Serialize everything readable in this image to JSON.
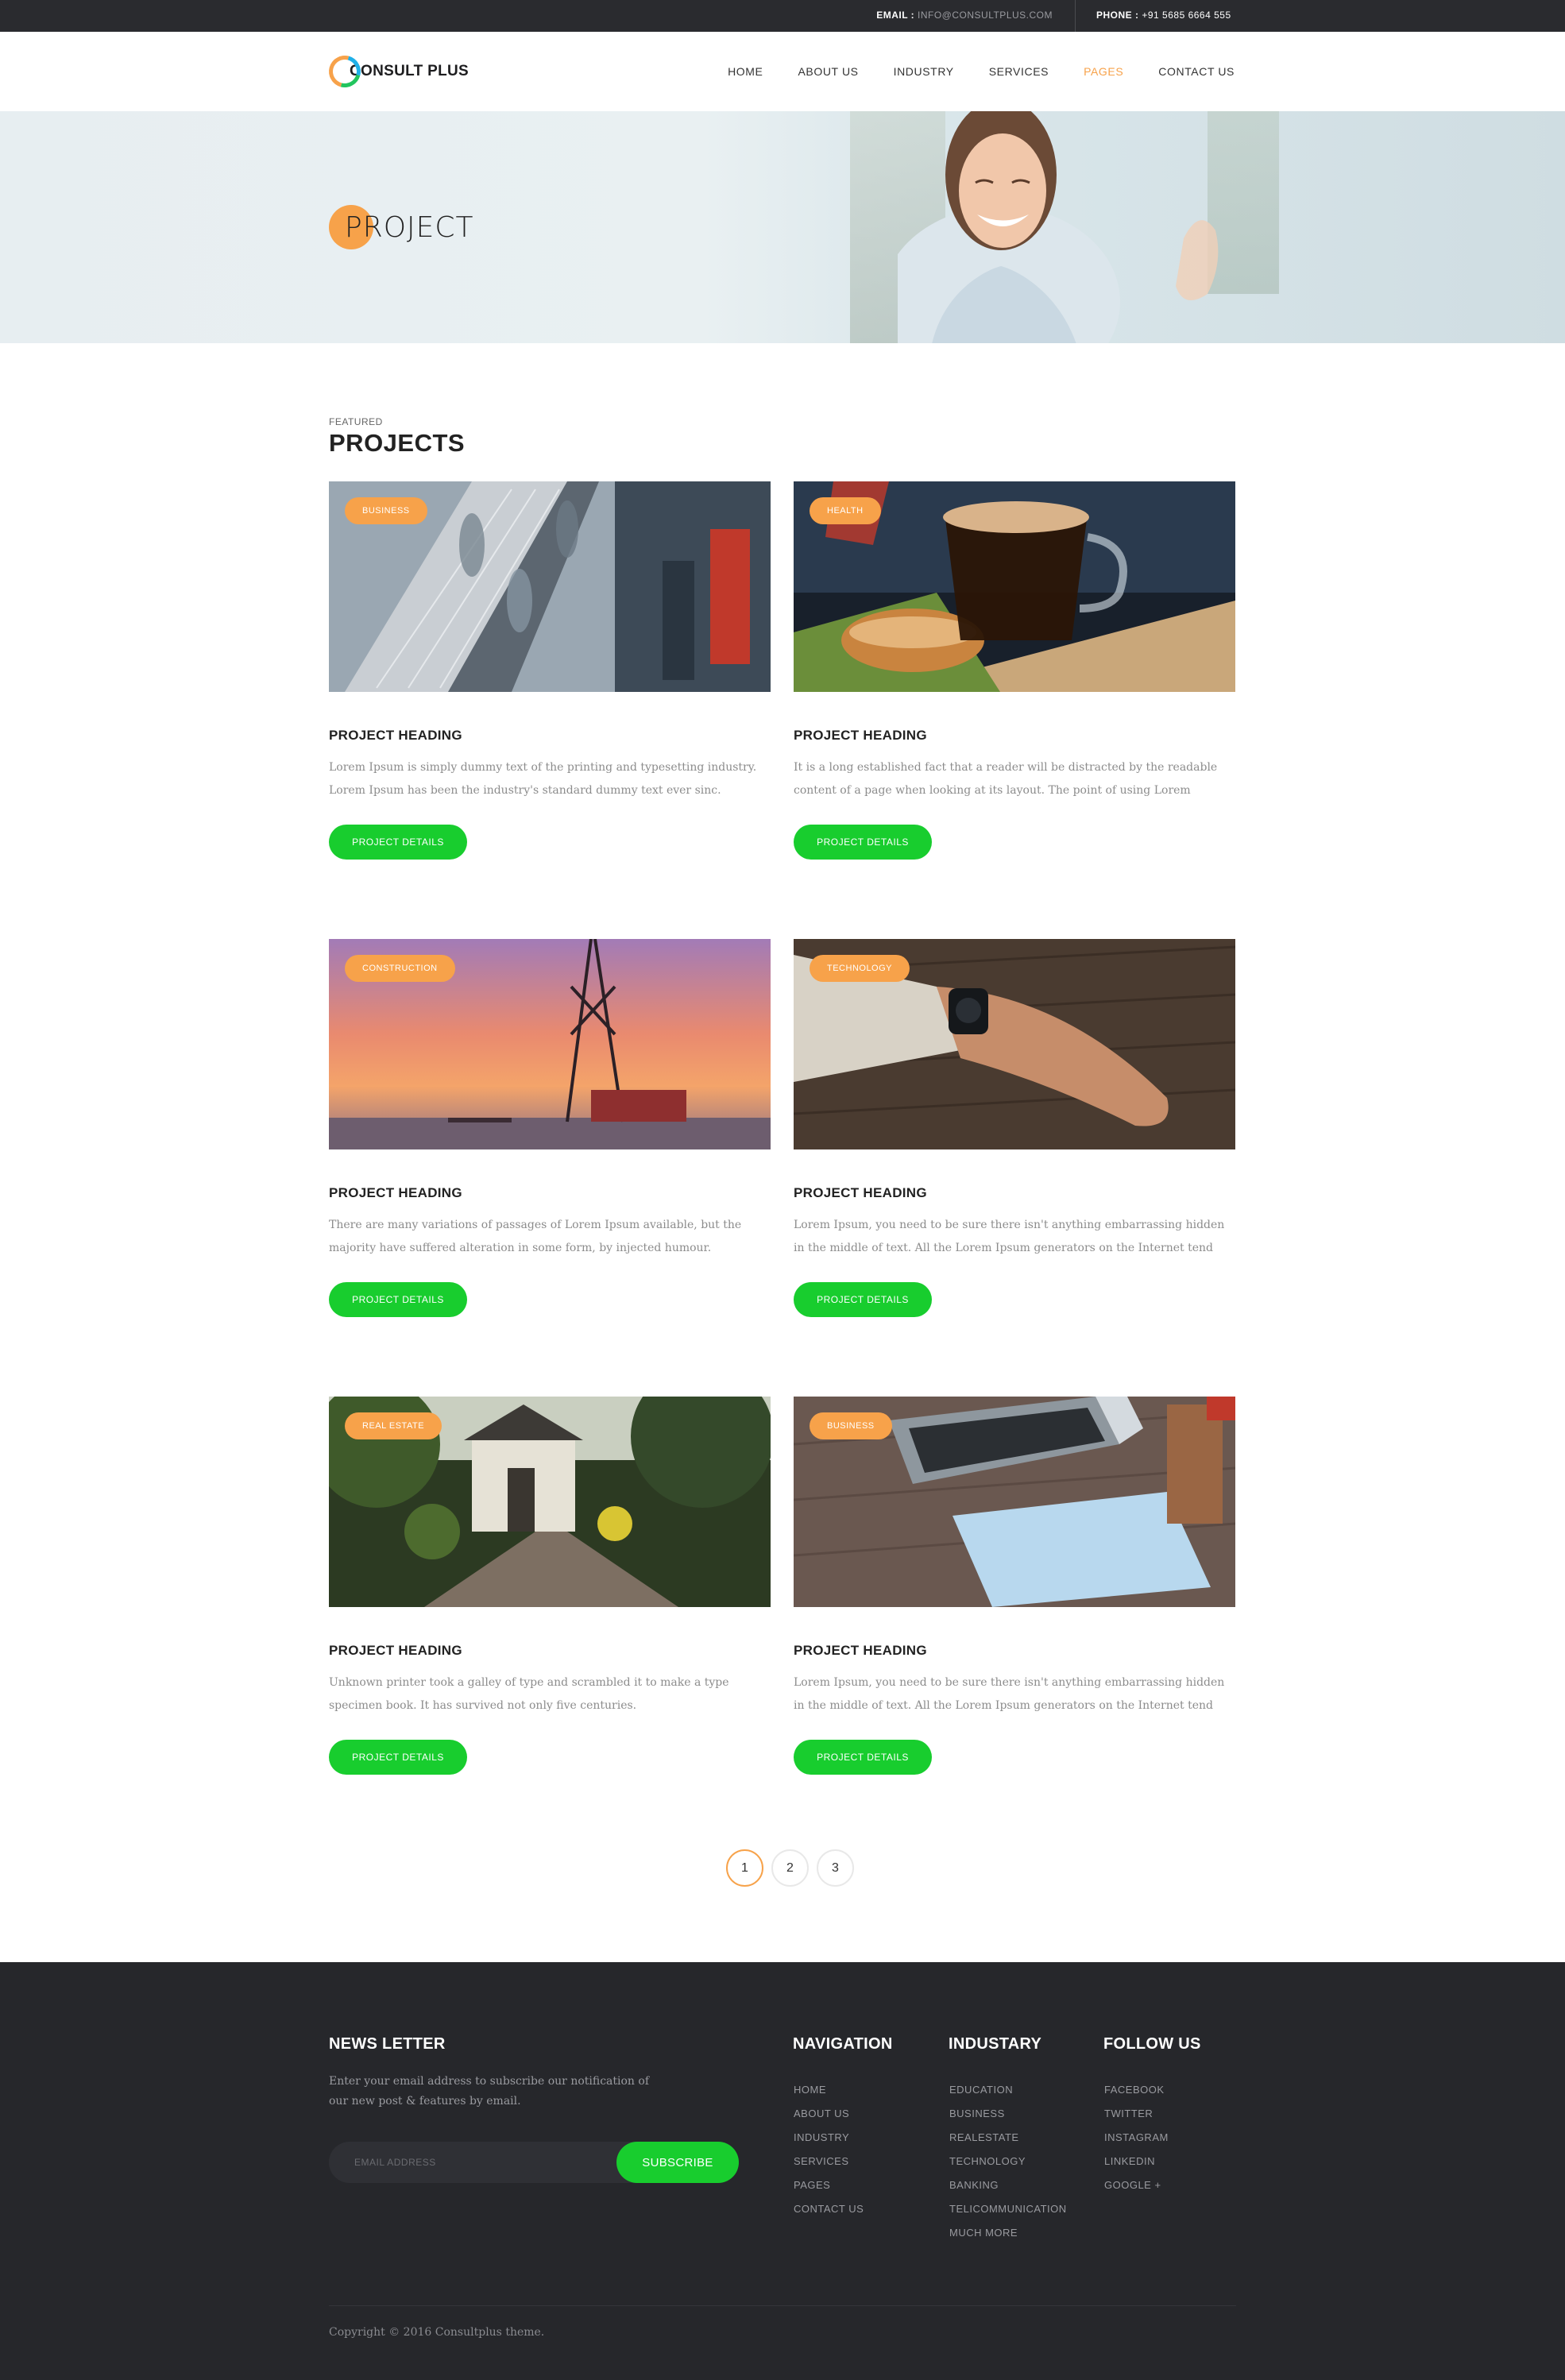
{
  "topbar": {
    "email_label": "EMAIL :",
    "email_value": "INFO@CONSULTPLUS.COM",
    "phone_label": "PHONE :",
    "phone_value": "+91 5685 6664 555"
  },
  "header": {
    "logo_text": "CONSULT PLUS",
    "nav": [
      "HOME",
      "ABOUT US",
      "INDUSTRY",
      "SERVICES",
      "PAGES",
      "CONTACT US"
    ],
    "active_nav": "PAGES"
  },
  "hero": {
    "title": "PROJECT"
  },
  "section": {
    "kicker": "FEATURED",
    "title": "PROJECTS"
  },
  "projects": [
    {
      "badge": "BUSINESS",
      "heading": "PROJECT HEADING",
      "text": "Lorem Ipsum is simply dummy text of the printing and typesetting industry. Lorem Ipsum has been the industry's standard dummy text ever sinc.",
      "button": "PROJECT DETAILS"
    },
    {
      "badge": "HEALTH",
      "heading": "PROJECT HEADING",
      "text": "It is a long established fact that a reader will be distracted by the readable content of a page when looking at its layout. The point of using Lorem",
      "button": "PROJECT DETAILS"
    },
    {
      "badge": "CONSTRUCTION",
      "heading": "PROJECT HEADING",
      "text": "There are many variations of passages of Lorem Ipsum available, but the majority have suffered alteration in some form, by injected humour.",
      "button": "PROJECT DETAILS"
    },
    {
      "badge": "TECHNOLOGY",
      "heading": "PROJECT HEADING",
      "text": "Lorem Ipsum, you need to be sure there isn't anything embarrassing hidden in the middle of text. All the Lorem Ipsum generators on the Internet tend",
      "button": "PROJECT DETAILS"
    },
    {
      "badge": "REAL ESTATE",
      "heading": "PROJECT HEADING",
      "text": "Unknown printer took a galley of type and scrambled it to make a type specimen book. It has survived not only five centuries.",
      "button": "PROJECT DETAILS"
    },
    {
      "badge": "BUSINESS",
      "heading": "PROJECT HEADING",
      "text": "Lorem Ipsum, you need to be sure there isn't anything embarrassing hidden in the middle of text. All the Lorem Ipsum generators on the Internet tend",
      "button": "PROJECT DETAILS"
    }
  ],
  "pagination": {
    "pages": [
      "1",
      "2",
      "3"
    ],
    "current": "1"
  },
  "footer": {
    "newsletter_title": "NEWS LETTER",
    "newsletter_text": "Enter your email address to subscribe our notification of our new post & features by email.",
    "email_placeholder": "EMAIL ADDRESS",
    "subscribe_label": "SUBSCRIBE",
    "navigation_title": "NAVIGATION",
    "navigation": [
      "HOME",
      "ABOUT US",
      "INDUSTRY",
      "SERVICES",
      "PAGES",
      "CONTACT US"
    ],
    "industry_title": "INDUSTARY",
    "industry": [
      "EDUCATION",
      "BUSINESS",
      "REALESTATE",
      "TECHNOLOGY",
      "BANKING",
      "TELICOMMUNICATION",
      "MUCH MORE"
    ],
    "follow_title": "FOLLOW US",
    "follow": [
      "FACEBOOK",
      "TWITTER",
      "INSTAGRAM",
      "LINKEDIN",
      "GOOGLE +"
    ],
    "copyright": "Copyright © 2016 Consultplus theme."
  },
  "colors": {
    "accent": "#f7a24a",
    "button_green": "#18cd2e",
    "dark": "#26272b"
  }
}
